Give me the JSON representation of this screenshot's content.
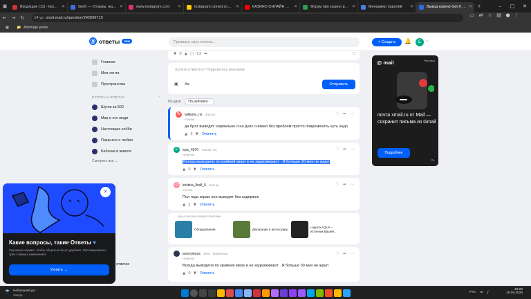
{
  "browser": {
    "tabs": [
      {
        "title": "Входящие (11) - luisetaltd...",
        "color": "#cc3333",
        "active": false
      },
      {
        "title": "GetX — Отзывы, жалобы...",
        "color": "#3a6fe0",
        "active": false
      },
      {
        "title": "www.instagram.com",
        "color": "#e1306c",
        "active": false
      },
      {
        "title": "instagram cloned sometimes...",
        "color": "#ffcc00",
        "active": false
      },
      {
        "title": "КАЗИНО ОНЛАЙН Вайб...",
        "color": "#ff0000",
        "active": false
      },
      {
        "title": "Форум про казино и не...",
        "color": "#2e9e4f",
        "active": false
      },
      {
        "title": "Менеджер паролей",
        "color": "#4a7de0",
        "active": false
      },
      {
        "title": "Вывод казино Get X 202...",
        "color": "#2f6ae8",
        "active": true
      }
    ],
    "zoom": "14 ур",
    "url": "otvet.mail.ru/question/242696719",
    "bookmark": "Arbitrage perks"
  },
  "header": {
    "logo_text": "ответы",
    "logo_badge": "new",
    "search_placeholder": "Призвать силу поиска...",
    "create_label": "Создать",
    "avatar_letter": "E"
  },
  "sidebar": {
    "main": [
      {
        "label": "Главная",
        "name": "home"
      },
      {
        "label": "Моя лента",
        "name": "my-feed"
      },
      {
        "label": "Пространства",
        "name": "spaces"
      }
    ],
    "trend_heading": "В ТОПЕ НА ОТВЕТАХ",
    "topics": [
      "Шутки за 500",
      "Мир и его люди",
      "Настоящие хобби",
      "Пикантно о любви",
      "Бабочки в животе"
    ],
    "more_label": "Смотреть все",
    "partial_label": "ответах"
  },
  "question_stats": {
    "votes": "0",
    "comments": "13"
  },
  "composer": {
    "placeholder": "Хотите ответить? Поделитесь мнением",
    "font_label": "Aa",
    "submit_label": "Отправить"
  },
  "sort": {
    "by_date": "По дате",
    "by_rating": "По рейтингу"
  },
  "answers": [
    {
      "author": "williams_rix",
      "meta": "Знаток",
      "rank": "Ученик",
      "avatar_letter": "W",
      "avatar_color": "#ff5a5a",
      "text": "да брат выводят нормально я на днях снимал без проблем просто повременить чуть надо",
      "votes": "3",
      "reply": "Ответить",
      "highlight": true,
      "selected": false
    },
    {
      "author": "epic_4970",
      "meta": "только что",
      "rank": "Новичок",
      "avatar_letter": "E",
      "avatar_color": "#00a884",
      "text": "Всегда выводили по крайней мере и не задерживают . Я больше 30 мин не ждал",
      "votes": "0",
      "reply": "Ответить",
      "highlight": false,
      "selected": true
    },
    {
      "author": "kristina_8will_5",
      "meta": "Знаток",
      "rank": "Ученик",
      "avatar_letter": "D",
      "avatar_color": "#ff8fa3",
      "text": "Пол года играю все выводят без задержек",
      "votes": "2",
      "reply": "Ответить",
      "highlight": false,
      "selected": false
    }
  ],
  "ads": {
    "label": "AQUA LAGUNA LANDRE  РЕКЛАМА",
    "items": [
      {
        "title": "Оборудование",
        "color": "#2a7fa8"
      },
      {
        "title": "Декорации и аксессуары",
        "color": "#5a7a3a"
      },
      {
        "title": "Laguna AQUA – источник Вашей...",
        "color": "#222222"
      }
    ]
  },
  "answer_bottom": {
    "author": "anonymous",
    "meta": "Знак",
    "meta2": "Изменена",
    "rank": "Новичок",
    "text": "Всегда выводили по крайней мере и не задерживают . Я больше 30 мин не ждал",
    "votes": "0",
    "reply": "Ответить"
  },
  "promo": {
    "brand": "mail",
    "rk": "Реклама",
    "text": "почта xmail.ru от Mail — сохранит письма из Gmail",
    "button": "Подробнее",
    "age": "0+"
  },
  "popup": {
    "title": "Какие вопросы, такие Ответы",
    "subtitle": "Улучшили сервис, чтобы общаться было удобнее. Рассказываем о трёх главных изменениях",
    "button": "Узнать"
  },
  "taskbar": {
    "weather_title": "Небольшой до...",
    "weather_sub": "Завтра",
    "lang": "РУС",
    "time": "18:00",
    "date": "19.09.2025"
  }
}
